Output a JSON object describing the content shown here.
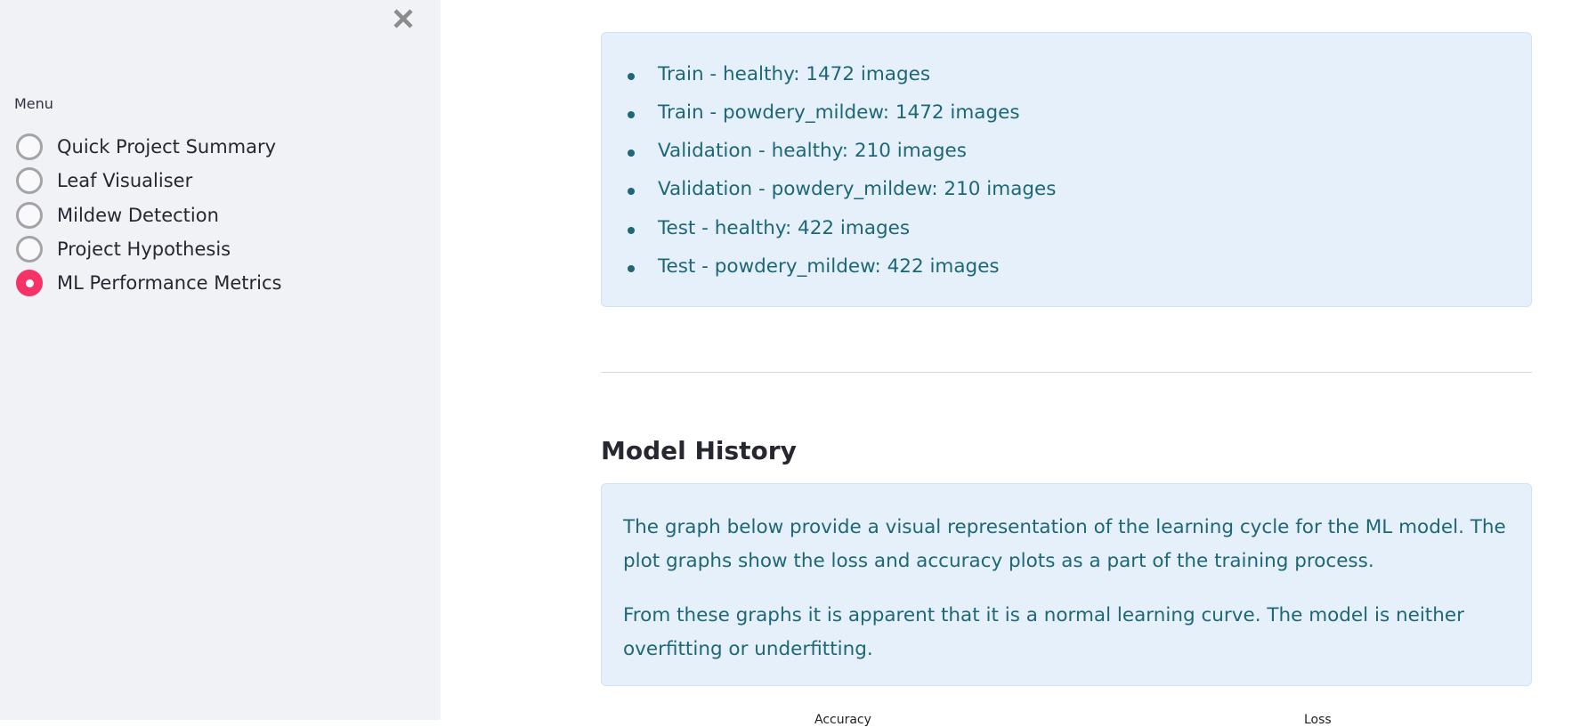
{
  "sidebar": {
    "close_icon": "close-icon",
    "menu_label": "Menu",
    "items": [
      {
        "label": "Quick Project Summary",
        "selected": false
      },
      {
        "label": "Leaf Visualiser",
        "selected": false
      },
      {
        "label": "Mildew Detection",
        "selected": false
      },
      {
        "label": "Project Hypothesis",
        "selected": false
      },
      {
        "label": "ML Performance Metrics",
        "selected": true
      }
    ],
    "accent_color": "#f63366"
  },
  "main": {
    "dataset_split": [
      "Train - healthy: 1472 images",
      "Train - powdery_mildew: 1472 images",
      "Validation - healthy: 210 images",
      "Validation - powdery_mildew: 210 images",
      "Test - healthy: 422 images",
      "Test - powdery_mildew: 422 images"
    ],
    "model_history": {
      "title": "Model History",
      "paragraphs": [
        "The graph below provide a visual representation of the learning cycle for the ML model. The plot graphs show the loss and accuracy plots as a part of the training process.",
        "From these graphs it is apparent that it is a normal learning curve. The model is neither overfitting or underfitting."
      ],
      "chart_titles": [
        "Accuracy",
        "Loss"
      ]
    },
    "info_text_color": "#1e6777",
    "info_bg_color": "#e6f0fb"
  }
}
